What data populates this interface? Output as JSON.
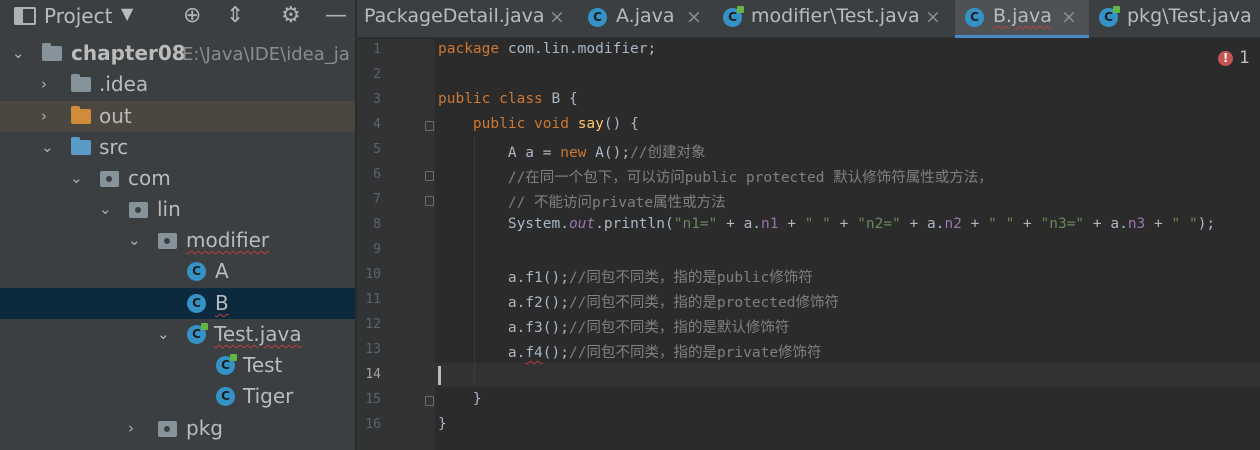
{
  "project_panel": {
    "title": "Project",
    "tree": [
      {
        "label": "chapter08",
        "path": "E:\\Java\\IDE\\idea_ja"
      },
      {
        "label": ".idea"
      },
      {
        "label": "out"
      },
      {
        "label": "src"
      },
      {
        "label": "com"
      },
      {
        "label": "lin"
      },
      {
        "label": "modifier"
      },
      {
        "label": "A"
      },
      {
        "label": "B"
      },
      {
        "label": "Test.java"
      },
      {
        "label": "Test"
      },
      {
        "label": "Tiger"
      },
      {
        "label": "pkg"
      }
    ]
  },
  "tabs": [
    {
      "label": "PackageDetail.java",
      "active": false
    },
    {
      "label": "A.java",
      "active": false
    },
    {
      "label": "modifier\\Test.java",
      "active": false
    },
    {
      "label": "B.java",
      "active": true
    },
    {
      "label": "pkg\\Test.java",
      "active": false
    }
  ],
  "icons": {
    "class_icon_letter": "C"
  },
  "editor": {
    "error_count": "1",
    "current_line": "14",
    "line_numbers": [
      "1",
      "2",
      "3",
      "4",
      "5",
      "6",
      "7",
      "8",
      "9",
      "10",
      "11",
      "12",
      "13",
      "14",
      "15",
      "16"
    ],
    "lines": {
      "l1": [
        "package",
        " com.lin.modifier;"
      ],
      "l3": [
        "public",
        " ",
        "class",
        " B {"
      ],
      "l4": [
        "    ",
        "public",
        " ",
        "void",
        " ",
        "say",
        "() {"
      ],
      "l5": [
        "        A a = ",
        "new",
        " A();",
        "//创建对象"
      ],
      "l6": [
        "        ",
        "//在同一个包下，可以访问public protected 默认修饰符属性或方法，"
      ],
      "l7": [
        "        ",
        "// 不能访问private属性或方法"
      ],
      "l8": [
        "        System.",
        "out",
        ".println(",
        "\"n1=\"",
        " + a.",
        "n1",
        " + ",
        "\" \"",
        " + ",
        "\"n2=\"",
        " + a.",
        "n2",
        " + ",
        "\" \"",
        " + ",
        "\"n3=\"",
        " + a.",
        "n3",
        " + ",
        "\" \"",
        ");"
      ],
      "l10": [
        "        a.f1();",
        "//同包不同类，指的是public修饰符"
      ],
      "l11": [
        "        a.f2();",
        "//同包不同类，指的是protected修饰符"
      ],
      "l12": [
        "        a.f3();",
        "//同包不同类，指的是默认修饰符"
      ],
      "l13": [
        "        a.",
        "f4",
        "();",
        "//同包不同类，指的是private修饰符"
      ],
      "l15": [
        "    }"
      ],
      "l16": [
        "}"
      ]
    }
  },
  "colors": {
    "keyword": "#cc7832",
    "string": "#6a8759",
    "comment": "#808080",
    "field": "#9876aa",
    "method": "#ffc66d",
    "class_icon": "#3592c4",
    "selection": "#0d293e",
    "tab_underline": "#4a88c7"
  }
}
